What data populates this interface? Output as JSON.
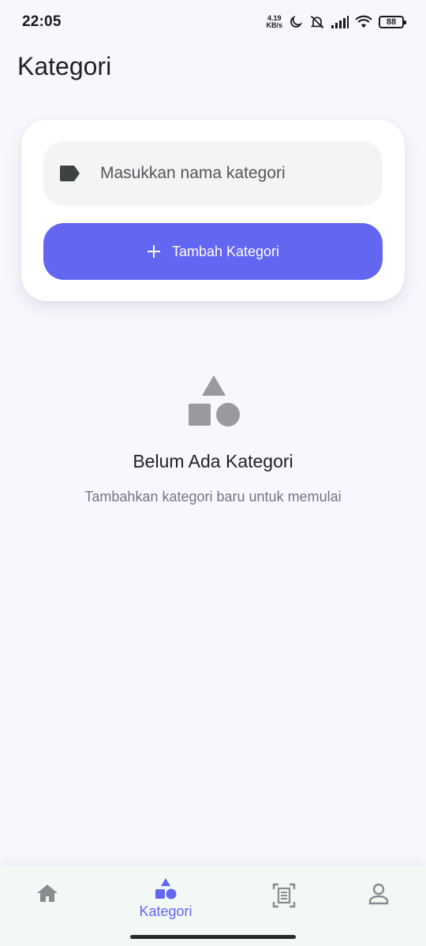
{
  "status_bar": {
    "time": "22:05",
    "net_speed_value": "4.19",
    "net_speed_unit": "KB/s",
    "battery": "88",
    "icons": [
      "moon-icon",
      "muted-bell-icon",
      "signal-icon",
      "wifi-icon",
      "battery-icon"
    ]
  },
  "header": {
    "title": "Kategori"
  },
  "form": {
    "input_placeholder": "Masukkan nama kategori",
    "input_value": "",
    "add_button_label": "Tambah Kategori"
  },
  "empty_state": {
    "title": "Belum Ada Kategori",
    "subtitle": "Tambahkan kategori baru untuk memulai"
  },
  "bottom_nav": {
    "items": [
      {
        "id": "home",
        "icon": "home-icon",
        "label": ""
      },
      {
        "id": "kategori",
        "icon": "category-shapes-icon",
        "label": "Kategori",
        "active": true
      },
      {
        "id": "report",
        "icon": "document-scan-icon",
        "label": ""
      },
      {
        "id": "profile",
        "icon": "person-icon",
        "label": ""
      }
    ]
  },
  "colors": {
    "accent": "#6366f1",
    "background": "#f7f7fd",
    "icon_inactive": "#8a8a90",
    "empty_icon": "#9a9a9e"
  }
}
